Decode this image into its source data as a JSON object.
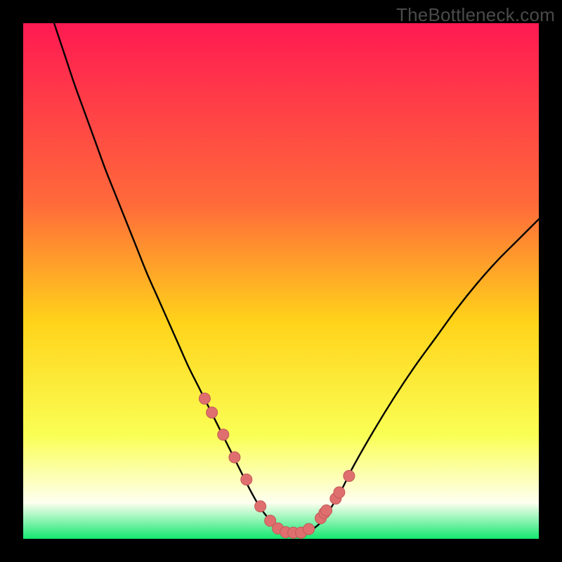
{
  "watermark": "TheBottleneck.com",
  "colors": {
    "gradient_top": "#ff1a52",
    "gradient_mid_upper": "#ff6a3a",
    "gradient_mid": "#ffd31a",
    "gradient_mid_lower": "#faff55",
    "gradient_lower": "#fefff0",
    "gradient_bottom": "#14e86f",
    "curve": "#000000",
    "marker_fill": "#df6f6e",
    "marker_stroke": "#c25856"
  },
  "chart_data": {
    "type": "line",
    "title": "",
    "xlabel": "",
    "ylabel": "",
    "xlim": [
      0,
      100
    ],
    "ylim": [
      0,
      100
    ],
    "series": [
      {
        "name": "bottleneck-curve",
        "x": [
          6,
          8,
          10,
          12,
          14,
          16,
          18,
          20,
          22,
          24,
          26,
          28,
          30,
          32,
          34,
          36,
          38,
          40,
          42,
          44,
          46,
          48,
          50,
          52,
          54,
          56,
          58,
          60,
          62,
          64,
          68,
          72,
          76,
          80,
          84,
          88,
          92,
          96,
          100
        ],
        "y": [
          100,
          94,
          88,
          82.5,
          77,
          71.5,
          66.5,
          61.5,
          56.5,
          51.5,
          47,
          42.5,
          38,
          33.5,
          29.5,
          25.5,
          21.5,
          17.5,
          13.5,
          9.5,
          6,
          3.5,
          1.8,
          1.1,
          1.1,
          1.8,
          3.5,
          6.5,
          10,
          14,
          21,
          27.5,
          33.5,
          39,
          44.5,
          49.5,
          54,
          58,
          62
        ]
      }
    ],
    "markers": {
      "name": "highlight-points",
      "x": [
        35.2,
        36.6,
        38.8,
        41.0,
        43.3,
        46.0,
        47.9,
        49.4,
        50.9,
        52.4,
        53.9,
        55.4,
        57.7,
        58.4,
        58.8,
        60.6,
        61.3,
        63.2
      ],
      "y": [
        27.2,
        24.5,
        20.2,
        15.8,
        11.5,
        6.3,
        3.5,
        2.0,
        1.3,
        1.2,
        1.2,
        1.9,
        4.0,
        5.0,
        5.5,
        7.8,
        9.0,
        12.2
      ]
    }
  }
}
